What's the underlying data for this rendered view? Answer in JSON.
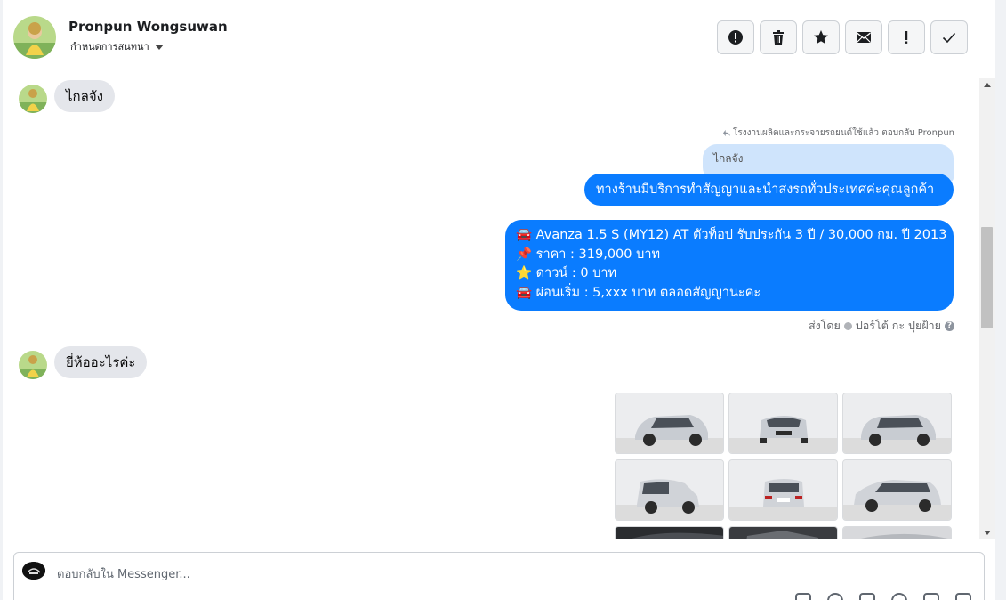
{
  "header": {
    "name": "Pronpun Wongsuwan",
    "assign_label": "กำหนดการสนทนา",
    "toolbar": [
      {
        "name": "spam-button",
        "icon": "alert-circle-icon"
      },
      {
        "name": "delete-button",
        "icon": "trash-icon"
      },
      {
        "name": "star-button",
        "icon": "star-icon"
      },
      {
        "name": "mark-unread-button",
        "icon": "envelope-icon"
      },
      {
        "name": "follow-up-button",
        "icon": "exclamation-icon"
      },
      {
        "name": "mark-done-button",
        "icon": "check-icon"
      }
    ]
  },
  "thread": {
    "msg1": "ไกลจัง",
    "reply_note": "โรงงานผลิตและกระจายรถยนต์ใช้แล้ว ตอบกลับ Pronpun",
    "quoted": "ไกลจัง",
    "reply_text": "ทางร้านมีบริการทำสัญญาและนำส่งรถทั่วประเทศค่ะคุณลูกค้า",
    "listing": {
      "line1": "🚘 Avanza 1.5 S (MY12) AT ตัวท็อป รับประกัน 3 ปี / 30,000 กม. ปี 2013",
      "line2": "📌 ราคา : 319,000 บาท",
      "line3": "⭐ ดาวน์ : 0 บาท",
      "line4": " 🚘 ผ่อนเริ่ม : 5,xxx บาท ตลอดสัญญานะคะ"
    },
    "sent_by_label": "ส่งโดย",
    "sent_by_name": "ปอร์โต้ กะ ปุยฝ้าย",
    "sent_by_help": "?",
    "msg2": "ยี่ห้ออะไรค่ะ"
  },
  "composer": {
    "placeholder": "ตอบกลับใน Messenger..."
  },
  "colors": {
    "outgoing_bubble": "#0a7cff",
    "incoming_bubble": "#e4e6eb",
    "quoted_bubble": "#cfe4fc"
  }
}
